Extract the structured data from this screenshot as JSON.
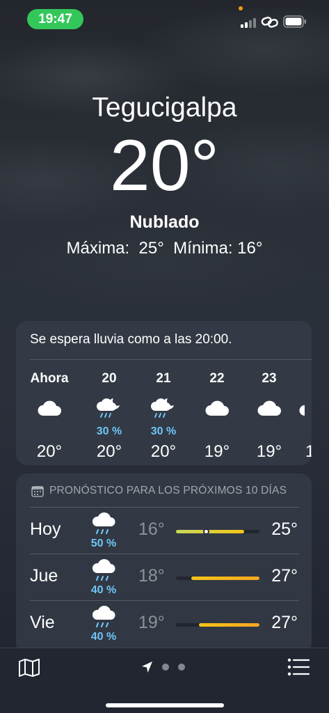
{
  "status_bar": {
    "time": "19:47",
    "icons": [
      "signal-icon",
      "link-icon",
      "battery-icon"
    ]
  },
  "header": {
    "city": "Tegucigalpa",
    "temperature": "20°",
    "condition": "Nublado",
    "hi_lo": "Máxima:  25°  Mínima: 16°"
  },
  "hourly": {
    "summary": "Se espera lluvia como a las 20:00.",
    "items": [
      {
        "label": "Ahora",
        "icon": "cloud-icon",
        "precip": "",
        "temp": "20°"
      },
      {
        "label": "20",
        "icon": "cloud-moon-rain-icon",
        "precip": "30 %",
        "temp": "20°"
      },
      {
        "label": "21",
        "icon": "cloud-moon-rain-icon",
        "precip": "30 %",
        "temp": "20°"
      },
      {
        "label": "22",
        "icon": "cloud-icon",
        "precip": "",
        "temp": "19°"
      },
      {
        "label": "23",
        "icon": "cloud-icon",
        "precip": "",
        "temp": "19°"
      },
      {
        "label": "",
        "icon": "",
        "precip": "",
        "temp": "1"
      }
    ]
  },
  "daily": {
    "header": "PRONÓSTICO PARA LOS PRÓXIMOS 10 DÍAS",
    "header_icon": "calendar-icon",
    "range_scale": [
      16,
      27
    ],
    "days": [
      {
        "name": "Hoy",
        "icon": "cloud-rain-icon",
        "precip": "50 %",
        "low": "16°",
        "high": "25°",
        "low_value": 16,
        "high_value": 25,
        "current_value": 20,
        "bar_colors": [
          "#c7d95a",
          "#f5c518"
        ]
      },
      {
        "name": "Jue",
        "icon": "cloud-rain-icon",
        "precip": "40 %",
        "low": "18°",
        "high": "27°",
        "low_value": 18,
        "high_value": 27,
        "bar_colors": [
          "#f5c518",
          "#f5a623"
        ]
      },
      {
        "name": "Vie",
        "icon": "cloud-rain-icon",
        "precip": "40 %",
        "low": "19°",
        "high": "27°",
        "low_value": 19,
        "high_value": 27,
        "bar_colors": [
          "#f5c518",
          "#f5a623"
        ]
      }
    ]
  },
  "bottom_bar": {
    "map_icon": "map-icon",
    "location_icon": "location-arrow-icon",
    "list_icon": "list-icon",
    "page_count": 2
  },
  "colors": {
    "status_pill": "#33c759",
    "precip_text": "#6ec6f5",
    "accent_dot": "#f39c12"
  }
}
